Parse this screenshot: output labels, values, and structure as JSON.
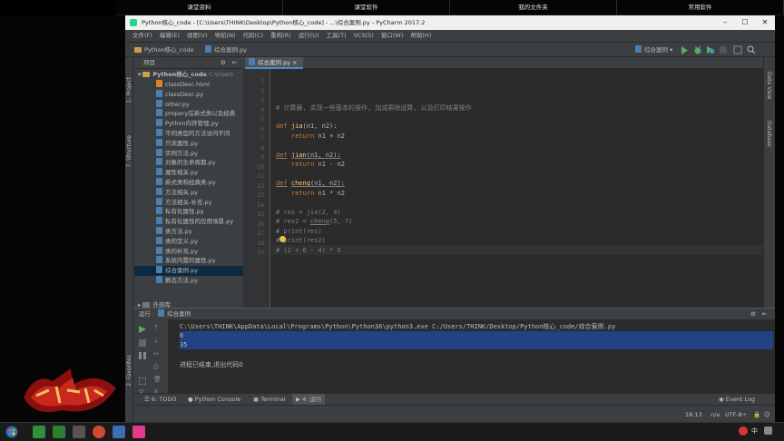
{
  "topbar": [
    "课堂资料",
    "课堂软件",
    "我的文件夹",
    "常用软件"
  ],
  "window": {
    "title": "Python核心_code - [C:\\Users\\THINK\\Desktop\\Python核心_code] - ...\\综合案例.py - PyCharm 2017.2",
    "minimize": "–",
    "maximize": "☐",
    "close": "✕"
  },
  "menu": [
    "文件(F)",
    "编辑(E)",
    "视图(V)",
    "导航(N)",
    "代码(C)",
    "重构(R)",
    "运行(U)",
    "工具(T)",
    "VCS(S)",
    "窗口(W)",
    "帮助(H)"
  ],
  "nav": {
    "project": "Python核心_code",
    "file": "综合案例.py",
    "run_config": "综合案例"
  },
  "side_tabs": {
    "project": "1: Project",
    "structure": "7: Structure",
    "favorites": "2: Favorites",
    "data_view": "Data View",
    "database": "Database"
  },
  "project_panel": {
    "header": "项目",
    "root": "Python核心_code",
    "root_path": "C:\\Users",
    "files": [
      "classDesc.html",
      "classDesc.py",
      "other.py",
      "propery在新式类以及经典",
      "Python内存管理.py",
      "不同类型的方法访问不同",
      "只读属性.py",
      "实例方法.py",
      "对象的生命周期.py",
      "属性相关.py",
      "新式类和经典类.py",
      "方法相关.py",
      "方法相关-补充.py",
      "私有化属性.py",
      "私有化属性的应用场景.py",
      "类方法.py",
      "类的定义.py",
      "类的补充.py",
      "系统内置的属性.py",
      "综合案例.py",
      "静态方法.py"
    ],
    "external": "外部库",
    "selected_index": 19
  },
  "editor": {
    "tab": "综合案例.py",
    "line_numbers": [
      "1",
      "2",
      "3",
      "4",
      "5",
      "6",
      "7",
      "8",
      "9",
      "10",
      "11",
      "12",
      "13",
      "14",
      "15",
      "16",
      "17",
      "18",
      "19"
    ]
  },
  "code": {
    "comment_header": "# 计算器, 实现一些基本的操作, 加减乘除运算, 以及打印结果操作",
    "def": "def",
    "return": "return",
    "fn1": "jia",
    "fn2": "jian",
    "fn3": "cheng",
    "params": "(n1, n2):",
    "ret1": " n1 + n2",
    "ret2": " n1 - n2",
    "ret3": " n1 * n2",
    "c15": "# res = jia(2, 4)",
    "c16a": "# res2 = ",
    "c16b": "cheng",
    "c16c": "(5, 7)",
    "c17": "# print(res)",
    "c18": "# print(res2)",
    "c19": "# (2 + 6 - 4) * 5"
  },
  "run": {
    "header": "运行",
    "config": "综合案例",
    "command": "C:\\Users\\THINK\\AppData\\Local\\Programs\\Python\\Python36\\python3.exe C:/Users/THINK/Desktop/Python核心_code/综合案例.py",
    "out1": "6",
    "out2": "35",
    "exit": "进程已结束,退出代码0"
  },
  "bottom_tabs": {
    "todo": "6: TODO",
    "console": "Python Console",
    "terminal": "Terminal",
    "run": "4: 运行",
    "event_log": "Event Log"
  },
  "status": {
    "position": "18:13",
    "sep": "n/a",
    "encoding": "UTF-8÷"
  },
  "taskbar": {
    "lang": "中"
  },
  "colors": {
    "accent": "#4a88c7",
    "keyword": "#cc7832",
    "function": "#ffc66d",
    "comment": "#808080",
    "selection": "#214283"
  }
}
